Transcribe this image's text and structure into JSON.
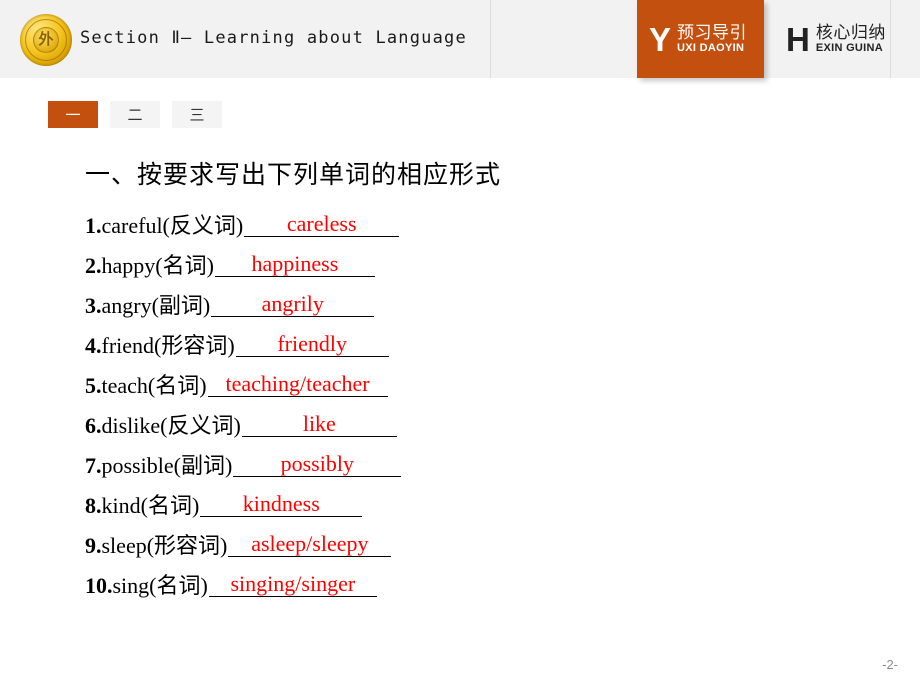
{
  "header": {
    "logo_glyph": "外",
    "section_title": "Section Ⅱ— Learning about Language",
    "nav_chips": [
      {
        "letter": "Y",
        "cn": "预习导引",
        "en": "UXI DAOYIN",
        "active": true,
        "accent": "#c4500f"
      },
      {
        "letter": "H",
        "cn": "核心归纳",
        "en": "EXIN GUINA",
        "active": false,
        "accent": "#222222"
      }
    ]
  },
  "tabs": [
    {
      "label": "一",
      "selected": true
    },
    {
      "label": "二",
      "selected": false
    },
    {
      "label": "三",
      "selected": false
    }
  ],
  "main": {
    "heading": "一、按要求写出下列单词的相应形式",
    "questions": [
      {
        "num": "1.",
        "prompt": "careful(反义词)",
        "answer": "careless",
        "blank_width": 155
      },
      {
        "num": "2.",
        "prompt": "happy(名词)",
        "answer": "happiness",
        "blank_width": 160
      },
      {
        "num": "3.",
        "prompt": "angry(副词)",
        "answer": "angrily",
        "blank_width": 163
      },
      {
        "num": "4.",
        "prompt": "friend(形容词)",
        "answer": "friendly",
        "blank_width": 153
      },
      {
        "num": "5.",
        "prompt": "teach(名词)",
        "answer": "teaching/teacher",
        "blank_width": 180
      },
      {
        "num": "6.",
        "prompt": "dislike(反义词)",
        "answer": "like",
        "blank_width": 155
      },
      {
        "num": "7.",
        "prompt": "possible(副词)",
        "answer": "possibly",
        "blank_width": 168
      },
      {
        "num": "8.",
        "prompt": "kind(名词)",
        "answer": "kindness",
        "blank_width": 162
      },
      {
        "num": "9.",
        "prompt": "sleep(形容词)",
        "answer": "asleep/sleepy",
        "blank_width": 163
      },
      {
        "num": "10.",
        "prompt": "sing(名词)",
        "answer": "singing/singer",
        "blank_width": 168
      }
    ]
  },
  "footer": {
    "page_number": "-2-"
  },
  "colors": {
    "accent_orange": "#c4500f",
    "answer_red": "#ff0000",
    "header_bg": "#f2f2f2",
    "page_bg": "#ffffff"
  }
}
